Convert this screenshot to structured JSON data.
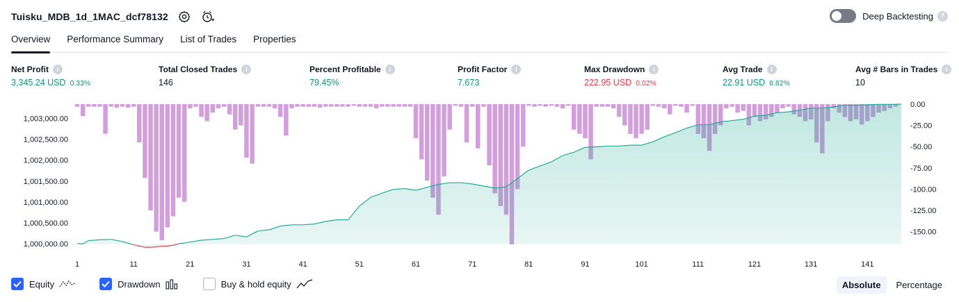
{
  "header": {
    "strategy_name": "Tuisku_MDB_1d_1MAC_dcf78132",
    "icons": [
      "settings-icon",
      "add-alert-icon"
    ],
    "deep_backtesting_label": "Deep Backtesting",
    "deep_backtesting_enabled": false
  },
  "tabs": [
    {
      "label": "Overview",
      "active": true
    },
    {
      "label": "Performance Summary",
      "active": false
    },
    {
      "label": "List of Trades",
      "active": false
    },
    {
      "label": "Properties",
      "active": false
    }
  ],
  "metrics": [
    {
      "label": "Net Profit",
      "value": "3,345.24 USD",
      "pct": "0.33%",
      "tone": "pos"
    },
    {
      "label": "Total Closed Trades",
      "value": "146",
      "pct": "",
      "tone": "neu"
    },
    {
      "label": "Percent Profitable",
      "value": "79.45%",
      "pct": "",
      "tone": "pos"
    },
    {
      "label": "Profit Factor",
      "value": "7.673",
      "pct": "",
      "tone": "pos"
    },
    {
      "label": "Max Drawdown",
      "value": "222.95 USD",
      "pct": "0.02%",
      "tone": "neg"
    },
    {
      "label": "Avg Trade",
      "value": "22.91 USD",
      "pct": "8.82%",
      "tone": "pos"
    },
    {
      "label": "Avg # Bars in Trades",
      "value": "10",
      "pct": "",
      "tone": "neu"
    }
  ],
  "colors": {
    "equity_line": "#22ab94",
    "equity_fill": "#22ab94",
    "equity_below_line": "#f23645",
    "drawdown_bar": "#ce93d8",
    "accent": "#2962ff",
    "positive": "#089981",
    "negative": "#f23645"
  },
  "chart_data": {
    "type": "area",
    "x_ticks": [
      "1",
      "11",
      "21",
      "31",
      "41",
      "51",
      "61",
      "71",
      "81",
      "91",
      "101",
      "111",
      "121",
      "131",
      "141"
    ],
    "left_axis_ticks": [
      "1,003,000.00",
      "1,002,500.00",
      "1,002,000.00",
      "1,001,500.00",
      "1,001,000.00",
      "1,000,500.00",
      "1,000,000.00"
    ],
    "right_axis_ticks": [
      "0.00",
      "-25.00",
      "-50.00",
      "-75.00",
      "-100.00",
      "-125.00",
      "-150.00"
    ],
    "left_ylim": [
      999980,
      1003345
    ],
    "right_ylim": [
      -165,
      0
    ],
    "xlim": [
      1,
      147
    ],
    "series": [
      {
        "name": "Equity",
        "axis": "left",
        "x": [
          1,
          2,
          3,
          5,
          7,
          9,
          11,
          12,
          13,
          14,
          15,
          16,
          17,
          18,
          19,
          21,
          23,
          25,
          27,
          29,
          30,
          31,
          33,
          35,
          37,
          39,
          41,
          43,
          45,
          47,
          49,
          51,
          53,
          55,
          57,
          59,
          61,
          63,
          65,
          67,
          69,
          71,
          73,
          75,
          77,
          79,
          81,
          83,
          85,
          87,
          89,
          91,
          93,
          95,
          97,
          99,
          101,
          103,
          105,
          107,
          109,
          111,
          113,
          115,
          117,
          119,
          121,
          123,
          125,
          127,
          129,
          131,
          133,
          135,
          137,
          139,
          141,
          143,
          145,
          147
        ],
        "values": [
          1000000,
          999990,
          1000070,
          1000090,
          1000100,
          1000050,
          999970,
          999940,
          999910,
          999910,
          999920,
          999935,
          999940,
          999960,
          999995,
          1000035,
          1000080,
          1000100,
          1000120,
          1000200,
          1000180,
          1000160,
          1000300,
          1000330,
          1000420,
          1000450,
          1000450,
          1000470,
          1000530,
          1000570,
          1000570,
          1000900,
          1001110,
          1001210,
          1001300,
          1001320,
          1001280,
          1001350,
          1001420,
          1001460,
          1001460,
          1001430,
          1001380,
          1001330,
          1001360,
          1001560,
          1001760,
          1001860,
          1001960,
          1002110,
          1002190,
          1002310,
          1002320,
          1002340,
          1002340,
          1002360,
          1002360,
          1002440,
          1002560,
          1002660,
          1002770,
          1002850,
          1002850,
          1002920,
          1002950,
          1002980,
          1003060,
          1003080,
          1003140,
          1003160,
          1003200,
          1003250,
          1003250,
          1003280,
          1003320,
          1003320,
          1003330,
          1003340,
          1003340,
          1003345
        ]
      },
      {
        "name": "Drawdown",
        "axis": "right",
        "type": "bar",
        "x": [
          1,
          2,
          3,
          4,
          5,
          6,
          7,
          8,
          9,
          10,
          11,
          12,
          13,
          14,
          15,
          16,
          17,
          18,
          19,
          20,
          21,
          22,
          23,
          24,
          25,
          26,
          27,
          28,
          29,
          30,
          31,
          32,
          33,
          34,
          35,
          36,
          37,
          38,
          39,
          40,
          41,
          42,
          43,
          44,
          45,
          46,
          47,
          48,
          49,
          50,
          51,
          52,
          53,
          54,
          55,
          56,
          57,
          58,
          59,
          60,
          61,
          62,
          63,
          64,
          65,
          66,
          67,
          68,
          69,
          70,
          71,
          72,
          73,
          74,
          75,
          76,
          77,
          78,
          79,
          80,
          81,
          82,
          83,
          84,
          85,
          86,
          87,
          88,
          89,
          90,
          91,
          92,
          93,
          94,
          95,
          96,
          97,
          98,
          99,
          100,
          101,
          102,
          103,
          104,
          105,
          106,
          107,
          108,
          109,
          110,
          111,
          112,
          113,
          114,
          115,
          116,
          117,
          118,
          119,
          120,
          121,
          122,
          123,
          124,
          125,
          126,
          127,
          128,
          129,
          130,
          131,
          132,
          133,
          134,
          135,
          136,
          137,
          138,
          139,
          140,
          141,
          142,
          143,
          144,
          145,
          146
        ],
        "values": [
          -3,
          -14,
          -3,
          -3,
          -3,
          -35,
          -3,
          -4,
          -3,
          -4,
          -3,
          -45,
          -87,
          -125,
          -150,
          -160,
          -145,
          -132,
          -110,
          -115,
          -5,
          -3,
          -15,
          -20,
          -10,
          -5,
          -3,
          -12,
          -30,
          -25,
          -63,
          -70,
          -3,
          -3,
          -3,
          -5,
          -15,
          -37,
          -5,
          -3,
          -3,
          -3,
          -3,
          -4,
          -3,
          -3,
          -3,
          -3,
          -3,
          -2,
          -3,
          -3,
          -3,
          -5,
          -3,
          -3,
          -3,
          -3,
          -3,
          -3,
          -40,
          -65,
          -90,
          -110,
          -130,
          -85,
          -30,
          -2,
          -3,
          -45,
          -3,
          -52,
          -3,
          -72,
          -105,
          -120,
          -130,
          -180,
          -100,
          -50,
          -2,
          -3,
          -2,
          -3,
          -2,
          -3,
          -5,
          -2,
          -30,
          -35,
          -40,
          -65,
          -3,
          -3,
          -3,
          -5,
          -15,
          -25,
          -35,
          -40,
          -35,
          -30,
          -2,
          -3,
          -5,
          -12,
          -2,
          -3,
          -10,
          -2,
          -35,
          -40,
          -55,
          -35,
          -25,
          -5,
          -3,
          -10,
          -8,
          -25,
          -15,
          -20,
          -18,
          -15,
          -10,
          -5,
          -3,
          -12,
          -15,
          -20,
          -18,
          -45,
          -58,
          -20,
          -5,
          -10,
          -15,
          -20,
          -18,
          -24,
          -20,
          -15,
          -10,
          -8,
          -5,
          -3
        ]
      }
    ]
  },
  "legend": {
    "equity_label": "Equity",
    "equity_checked": true,
    "drawdown_label": "Drawdown",
    "drawdown_checked": true,
    "buyhold_label": "Buy & hold equity",
    "buyhold_checked": false
  },
  "mode": {
    "absolute_label": "Absolute",
    "percentage_label": "Percentage",
    "active": "absolute"
  }
}
